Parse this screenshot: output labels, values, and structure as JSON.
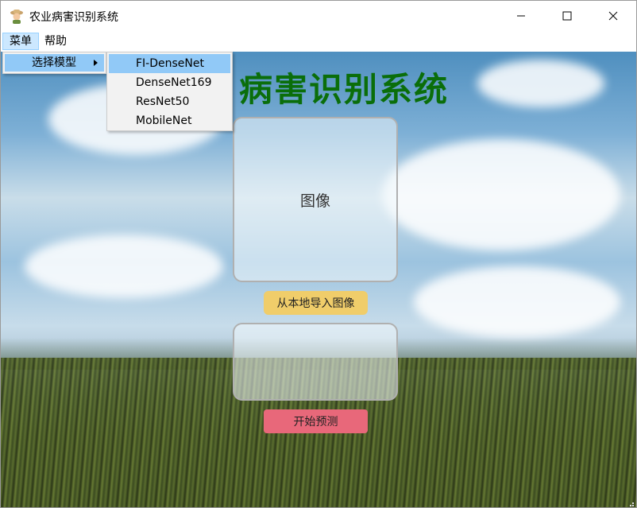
{
  "window": {
    "title": "农业病害识别系统",
    "icon": "farmer-icon"
  },
  "menubar": {
    "items": [
      {
        "label": "菜单"
      },
      {
        "label": "帮助"
      }
    ]
  },
  "dropdown": {
    "submenu_label": "选择模型",
    "models": [
      "FI-DenseNet",
      "DenseNet169",
      "ResNet50",
      "MobileNet"
    ],
    "selected": "FI-DenseNet"
  },
  "main": {
    "title": "农业病害识别系统",
    "visible_title": "病害识别系统",
    "image_placeholder": "图像",
    "import_button": "从本地导入图像",
    "predict_button": "开始预测"
  },
  "colors": {
    "title_green": "#0a6e0a",
    "import_button": "#f0cd6a",
    "predict_button": "#e8687a",
    "menu_highlight": "#91c9f7"
  }
}
